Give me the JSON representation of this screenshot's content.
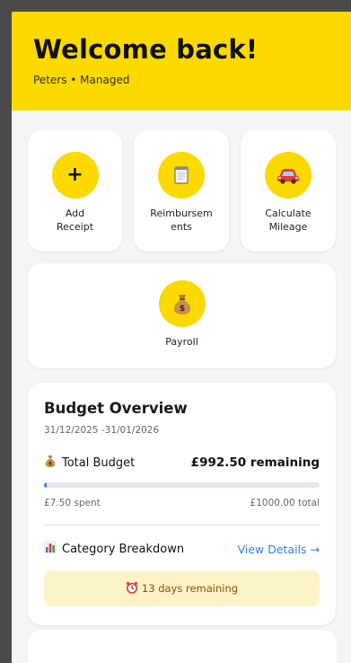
{
  "header": {
    "title": "Welcome back!",
    "subtitle": "Peters • Managed"
  },
  "quick_actions": [
    {
      "label": "Add Receipt",
      "icon": "plus-icon"
    },
    {
      "label": "Reimbursements",
      "icon": "notepad-icon"
    },
    {
      "label": "Calculate Mileage",
      "icon": "car-icon"
    },
    {
      "label": "Payroll",
      "icon": "money-bag-icon"
    }
  ],
  "budget": {
    "title": "Budget Overview",
    "date_range": "31/12/2025 -31/01/2026",
    "total_label": "Total Budget",
    "remaining": "£992.50 remaining",
    "spent": "£7.50 spent",
    "total": "£1000.00 total",
    "progress_fraction": 0.0075,
    "category_label": "Category Breakdown",
    "view_details": "View Details →",
    "days_remaining": "13 days remaining"
  },
  "colors": {
    "brand_yellow": "#fcd900",
    "link_blue": "#2f80ed",
    "notice_bg": "#fdf3c8",
    "notice_text": "#8a5300"
  }
}
